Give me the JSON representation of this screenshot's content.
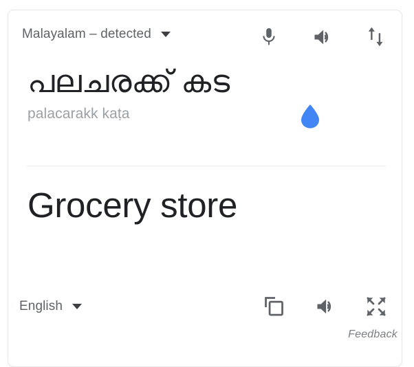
{
  "card": {
    "source": {
      "language_label": "Malayalam – detected",
      "dropdown_icon": "chevron-down-icon",
      "text": "പലചരക്ക് കട",
      "transliteration": "palacarakk kaṭa",
      "actions": [
        {
          "icon": "microphone-icon",
          "name": "voice-input-button"
        },
        {
          "icon": "speaker-icon",
          "name": "listen-source-button"
        },
        {
          "icon": "swap-arrows-icon",
          "name": "swap-languages-button"
        }
      ],
      "marker_icon": "water-drop-icon"
    },
    "target": {
      "text": "Grocery store",
      "language_label": "English",
      "dropdown_icon": "chevron-down-icon",
      "actions": [
        {
          "icon": "copy-icon",
          "name": "copy-translation-button"
        },
        {
          "icon": "speaker-icon",
          "name": "listen-translation-button"
        },
        {
          "icon": "fullscreen-icon",
          "name": "fullscreen-button"
        }
      ]
    },
    "feedback_label": "Feedback"
  },
  "colors": {
    "accent_blue": "#4285f4",
    "icon_gray": "#5f6368",
    "text_primary": "#202124",
    "text_secondary": "#9aa0a6",
    "divider": "#eceded"
  }
}
